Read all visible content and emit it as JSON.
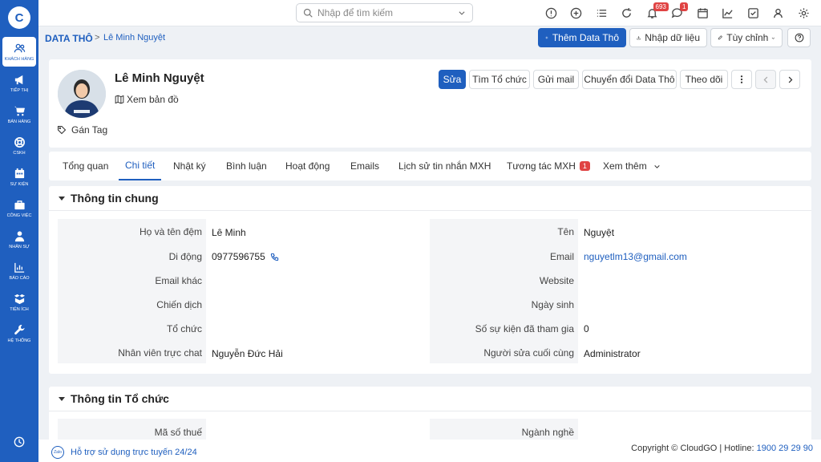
{
  "sidebar": {
    "logo": "C",
    "items": [
      {
        "label": "KHÁCH HÀNG",
        "icon": "users-icon",
        "active": true
      },
      {
        "label": "TIẾP THỊ",
        "icon": "megaphone-icon"
      },
      {
        "label": "BÁN HÀNG",
        "icon": "cart-icon"
      },
      {
        "label": "CSKH",
        "icon": "lifebuoy-icon"
      },
      {
        "label": "SỰ KIỆN",
        "icon": "calendar-icon"
      },
      {
        "label": "CÔNG VIỆC",
        "icon": "briefcase-icon"
      },
      {
        "label": "NHÂN SỰ",
        "icon": "person-icon"
      },
      {
        "label": "BÁO CÁO",
        "icon": "report-icon"
      },
      {
        "label": "TIỆN ÍCH",
        "icon": "boxes-icon"
      },
      {
        "label": "HỆ THỐNG",
        "icon": "wrench-icon"
      }
    ]
  },
  "topbar": {
    "search_placeholder": "Nhập để tìm kiếm",
    "notifications_count": "693",
    "messages_count": "1"
  },
  "breadcrumb": {
    "root": "DATA THÔ",
    "sep": ">",
    "current": "Lê Minh Nguyệt"
  },
  "actions": {
    "add": "Thêm Data Thô",
    "import": "Nhập dữ liệu",
    "customize": "Tùy chỉnh"
  },
  "profile": {
    "name": "Lê Minh Nguyệt",
    "map_link": "Xem bản đồ",
    "tag_label": "Gán Tag",
    "buttons": {
      "edit": "Sửa",
      "find_org": "Tìm Tổ chức",
      "send_mail": "Gửi mail",
      "convert": "Chuyển đổi Data Thô",
      "follow": "Theo dõi"
    }
  },
  "tabs": [
    {
      "label": "Tổng quan"
    },
    {
      "label": "Chi tiết",
      "active": true
    },
    {
      "label": "Nhật ký"
    },
    {
      "label": "Bình luận"
    },
    {
      "label": "Hoạt động"
    },
    {
      "label": "Emails"
    },
    {
      "label": "Lịch sử tin nhắn MXH"
    },
    {
      "label": "Tương tác MXH",
      "badge": "1"
    },
    {
      "label": "Xem thêm"
    }
  ],
  "section_general": {
    "title": "Thông tin chung",
    "fields": {
      "middle_name_label": "Họ và tên đệm",
      "middle_name": "Lê Minh",
      "first_name_label": "Tên",
      "first_name": "Nguyệt",
      "mobile_label": "Di động",
      "mobile": "0977596755",
      "email_label": "Email",
      "email": "nguyetlm13@gmail.com",
      "other_email_label": "Email khác",
      "other_email": "",
      "website_label": "Website",
      "website": "",
      "campaign_label": "Chiến dịch",
      "campaign": "",
      "birthday_label": "Ngày sinh",
      "birthday": "",
      "org_label": "Tổ chức",
      "org": "",
      "events_label": "Số sự kiện đã tham gia",
      "events": "0",
      "staff_label": "Nhân viên trực chat",
      "staff": "Nguyễn Đức Hải",
      "modified_by_label": "Người sửa cuối cùng",
      "modified_by": "Administrator"
    }
  },
  "section_org": {
    "title": "Thông tin Tổ chức",
    "fields": {
      "tax_label": "Mã số thuế",
      "tax": "",
      "industry_label": "Ngành nghề",
      "industry": ""
    }
  },
  "footer": {
    "zalo": "Zalo",
    "support": "Hỗ trợ sử dụng trực tuyến 24/24",
    "copyright": "Copyright © CloudGO | Hotline: ",
    "hotline": "1900 29 29 90"
  }
}
